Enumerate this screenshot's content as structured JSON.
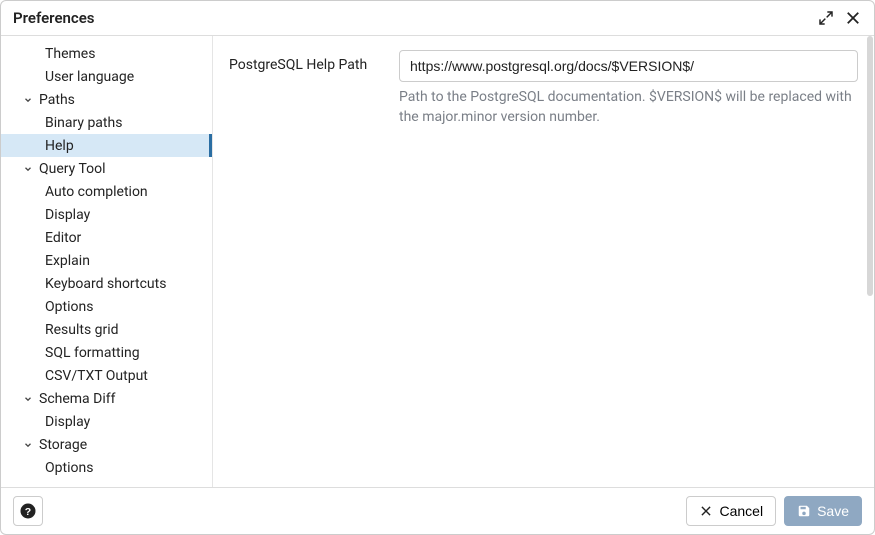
{
  "title": "Preferences",
  "sidebar": {
    "leading_leaves": [
      "Themes",
      "User language"
    ],
    "groups": [
      {
        "label": "Paths",
        "items": [
          "Binary paths",
          "Help"
        ],
        "selected_index": 1
      },
      {
        "label": "Query Tool",
        "items": [
          "Auto completion",
          "Display",
          "Editor",
          "Explain",
          "Keyboard shortcuts",
          "Options",
          "Results grid",
          "SQL formatting",
          "CSV/TXT Output"
        ]
      },
      {
        "label": "Schema Diff",
        "items": [
          "Display"
        ]
      },
      {
        "label": "Storage",
        "items": [
          "Options"
        ]
      }
    ]
  },
  "form": {
    "field_label": "PostgreSQL Help Path",
    "value": "https://www.postgresql.org/docs/$VERSION$/",
    "help_text": "Path to the PostgreSQL documentation. $VERSION$ will be replaced with the major.minor version number."
  },
  "footer": {
    "cancel_label": "Cancel",
    "save_label": "Save"
  }
}
